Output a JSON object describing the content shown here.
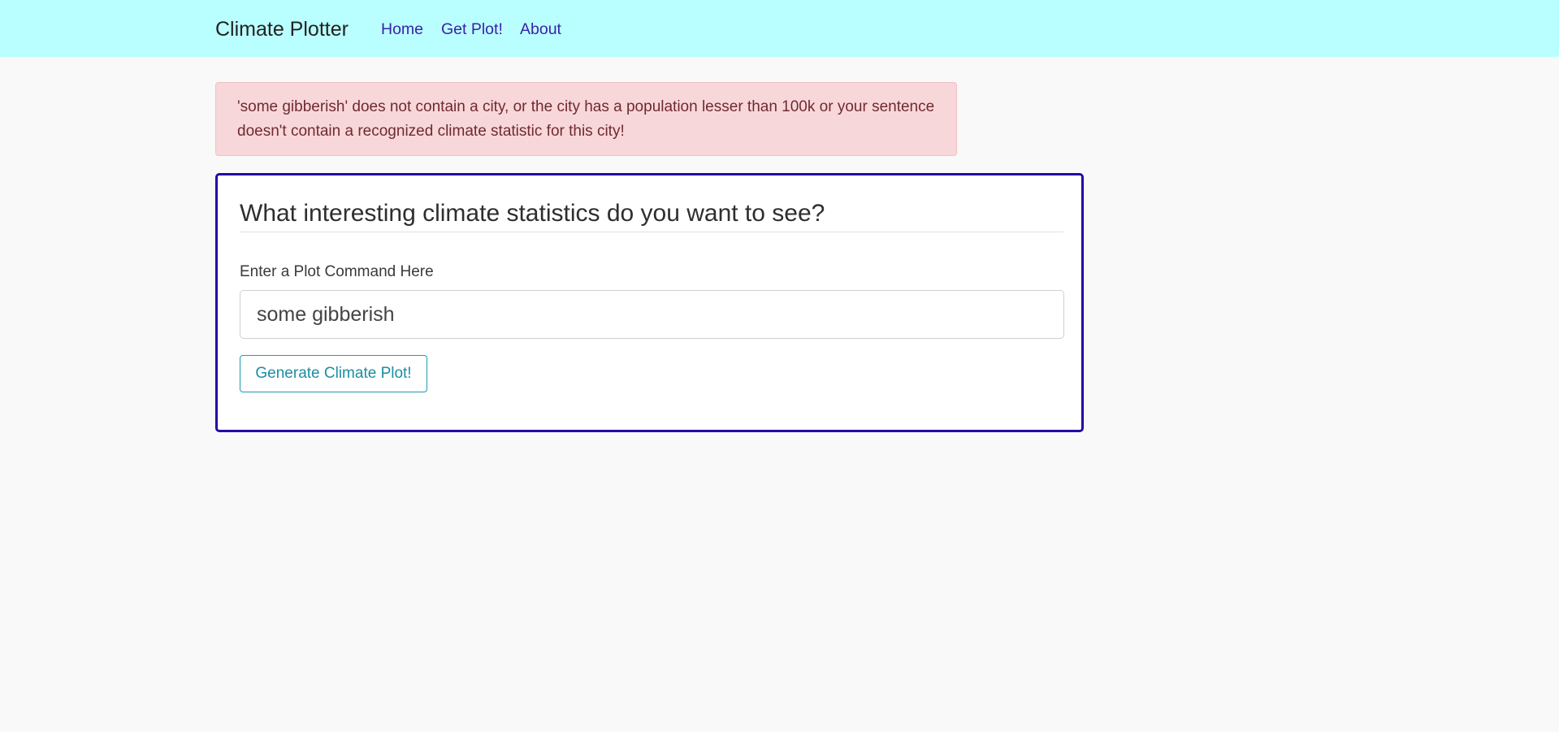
{
  "navbar": {
    "brand": "Climate Plotter",
    "links": [
      {
        "label": "Home"
      },
      {
        "label": "Get Plot!"
      },
      {
        "label": "About"
      }
    ],
    "background": "#baffff",
    "link_color": "#3a22a8"
  },
  "alert": {
    "message": "'some gibberish' does not contain a city, or the city has a population lesser than 100k or your sentence doesn't contain a recognized climate statistic for this city!",
    "type": "danger",
    "background": "#f8d7da"
  },
  "form": {
    "title": "What interesting climate statistics do you want to see?",
    "input_label": "Enter a Plot Command Here",
    "input_value": "some gibberish",
    "submit_label": "Generate Climate Plot!",
    "border_color": "#2a00a5",
    "button_color": "#1c9bb0"
  }
}
